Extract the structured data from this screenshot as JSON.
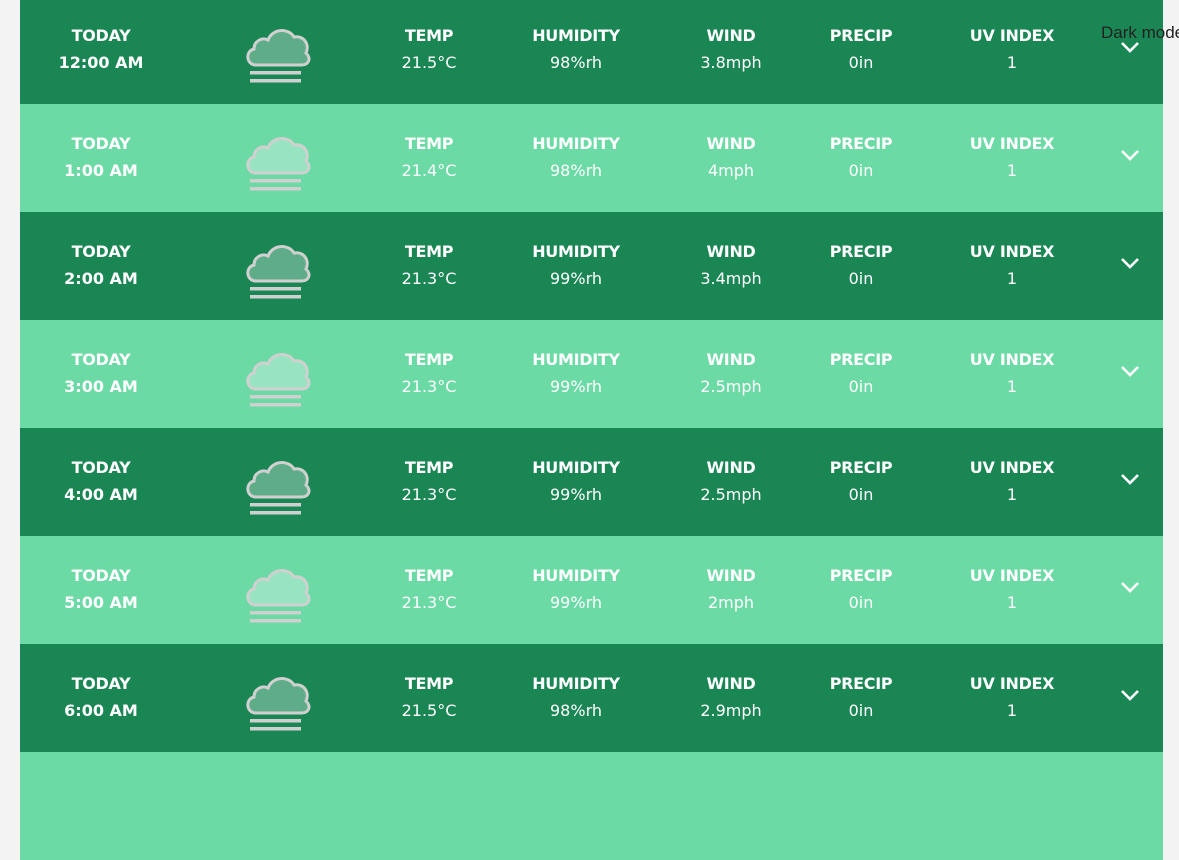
{
  "dark_mode_label": "Dark mode",
  "colors": {
    "row_dark": "#1a8654",
    "row_light": "#6bdaa5",
    "background": "#f3f3f3"
  },
  "labels": {
    "temp": "TEMP",
    "humidity": "HUMIDITY",
    "wind": "WIND",
    "precip": "PRECIP",
    "uv": "UV INDEX"
  },
  "rows": [
    {
      "day": "TODAY",
      "time": "12:00 AM",
      "icon": "fog-cloud-icon",
      "temp": "21.5°C",
      "humidity": "98%rh",
      "wind": "3.8mph",
      "precip": "0in",
      "uv": "1"
    },
    {
      "day": "TODAY",
      "time": "1:00 AM",
      "icon": "fog-cloud-icon",
      "temp": "21.4°C",
      "humidity": "98%rh",
      "wind": "4mph",
      "precip": "0in",
      "uv": "1"
    },
    {
      "day": "TODAY",
      "time": "2:00 AM",
      "icon": "fog-cloud-icon",
      "temp": "21.3°C",
      "humidity": "99%rh",
      "wind": "3.4mph",
      "precip": "0in",
      "uv": "1"
    },
    {
      "day": "TODAY",
      "time": "3:00 AM",
      "icon": "fog-cloud-icon",
      "temp": "21.3°C",
      "humidity": "99%rh",
      "wind": "2.5mph",
      "precip": "0in",
      "uv": "1"
    },
    {
      "day": "TODAY",
      "time": "4:00 AM",
      "icon": "fog-cloud-icon",
      "temp": "21.3°C",
      "humidity": "99%rh",
      "wind": "2.5mph",
      "precip": "0in",
      "uv": "1"
    },
    {
      "day": "TODAY",
      "time": "5:00 AM",
      "icon": "fog-cloud-icon",
      "temp": "21.3°C",
      "humidity": "99%rh",
      "wind": "2mph",
      "precip": "0in",
      "uv": "1"
    },
    {
      "day": "TODAY",
      "time": "6:00 AM",
      "icon": "fog-cloud-icon",
      "temp": "21.5°C",
      "humidity": "98%rh",
      "wind": "2.9mph",
      "precip": "0in",
      "uv": "1"
    },
    {}
  ]
}
